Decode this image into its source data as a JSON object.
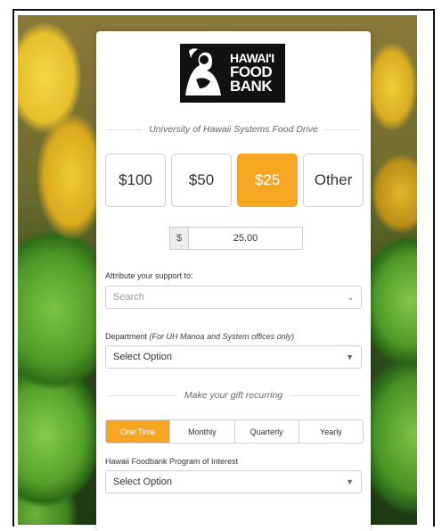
{
  "brand": {
    "logo_line1": "HAWAI'I",
    "logo_line2": "FOOD",
    "logo_line3": "BANK"
  },
  "drive_title": "University of Hawaii Systems Food Drive",
  "amounts": [
    {
      "label": "$100",
      "selected": false
    },
    {
      "label": "$50",
      "selected": false
    },
    {
      "label": "$25",
      "selected": true
    },
    {
      "label": "Other",
      "selected": false
    }
  ],
  "amount_input": {
    "currency": "$",
    "value": "25.00"
  },
  "attribute": {
    "label": "Attribute your support to:",
    "placeholder": "Search"
  },
  "department": {
    "label_prefix": "Department",
    "label_note": "(For UH Manoa and System offices only)",
    "value": "Select Option"
  },
  "recurring_title": "Make your gift recurring",
  "frequency": [
    {
      "label": "One Time",
      "selected": true
    },
    {
      "label": "Monthly",
      "selected": false
    },
    {
      "label": "Quarterly",
      "selected": false
    },
    {
      "label": "Yearly",
      "selected": false
    }
  ],
  "program": {
    "label": "Hawaii Foodbank Program of Interest",
    "value": "Select Option"
  },
  "colors": {
    "accent": "#f5a623",
    "border": "#cfcfcf"
  }
}
